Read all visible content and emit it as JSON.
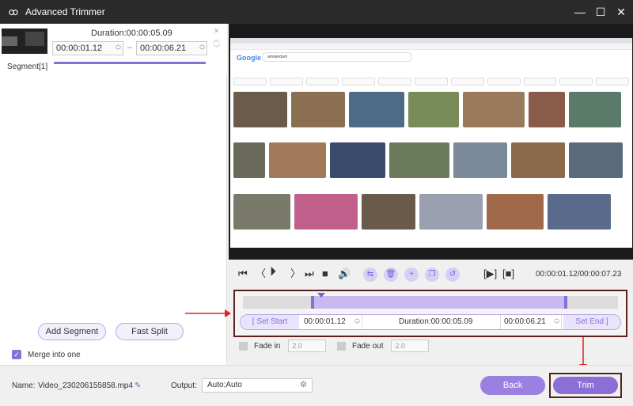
{
  "window": {
    "title": "Advanced Trimmer"
  },
  "segment": {
    "duration": "Duration:00:00:05.09",
    "start": "00:00:01.12",
    "end": "00:00:06.21",
    "label": "Segment[1]"
  },
  "left_buttons": {
    "add_segment": "Add Segment",
    "fast_split": "Fast Split"
  },
  "merge": {
    "label": "Merge into one",
    "checked": true
  },
  "preview": {
    "google_logo": "Google",
    "search_text": "amsterdam"
  },
  "player": {
    "timecode": "00:00:01.12/00:00:07.23"
  },
  "trim_row": {
    "set_start": "Set Start",
    "start": "00:00:01.12",
    "duration": "Duration:00:00:05.09",
    "end": "00:00:06.21",
    "set_end": "Set End"
  },
  "fade": {
    "fade_in_label": "Fade in",
    "fade_in_value": "2.0",
    "fade_out_label": "Fade out",
    "fade_out_value": "2.0"
  },
  "bottom": {
    "name_label": "Name:",
    "name_value": "Video_230206155858.mp4",
    "output_label": "Output:",
    "output_value": "Auto;Auto",
    "back": "Back",
    "trim": "Trim"
  },
  "colors": {
    "accent": "#8a70d6",
    "highlight_border": "#5a2020",
    "arrow": "#e02020"
  }
}
